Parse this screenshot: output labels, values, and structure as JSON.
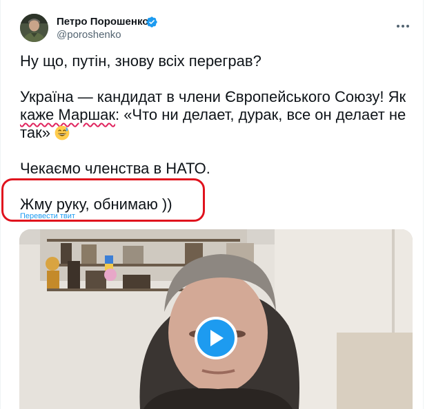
{
  "author": {
    "name": "Петро Порошенко",
    "handle": "@poroshenko",
    "verified": true
  },
  "tweet": {
    "line1": "Ну що, путін, знову всіх переграв?",
    "line2_start": "Україна — кандидат в члени Європейського Союзу! Як ",
    "line2_underlined": "каже Маршак",
    "line2_end": ": «Что ни делает, дурак, все он делает не так» ",
    "line2_emoji": "grinning-sweat-emoji",
    "line3": "Чекаємо членства в НАТО.",
    "line4": "Жму руку, обнимаю ))"
  },
  "translate_link": "Перевести твит",
  "media": {
    "type": "video",
    "icon": "play-icon"
  },
  "colors": {
    "accent": "#1d9bf0",
    "highlight": "#e0121d",
    "text": "#0f1419",
    "secondary_text": "#536471"
  }
}
